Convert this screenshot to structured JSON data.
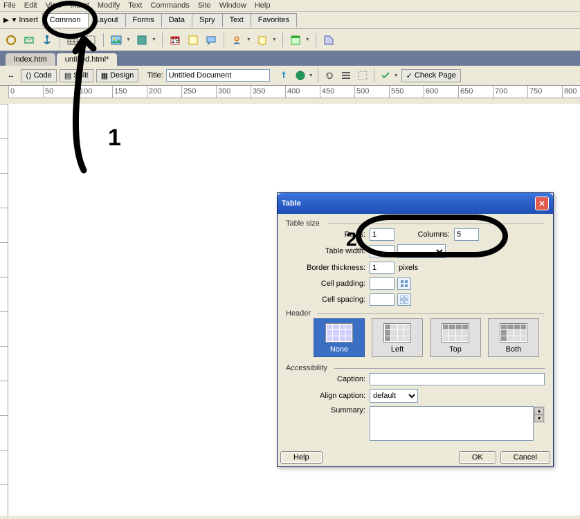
{
  "menu": [
    "File",
    "Edit",
    "View",
    "Insert",
    "Modify",
    "Text",
    "Commands",
    "Site",
    "Window",
    "Help"
  ],
  "insert": {
    "label": "Insert",
    "tabs": [
      "Common",
      "Layout",
      "Forms",
      "Data",
      "Spry",
      "Text",
      "Favorites"
    ],
    "active": 0
  },
  "doc_tabs": [
    {
      "label": "index.htm",
      "active": false
    },
    {
      "label": "untitled.html*",
      "active": true
    }
  ],
  "doc_toolbar": {
    "code": "Code",
    "split": "Split",
    "design": "Design",
    "title_label": "Title:",
    "title_value": "Untitled Document",
    "check_page": "Check Page"
  },
  "annotations": {
    "n1": "1",
    "n2": "2"
  },
  "dialog": {
    "title": "Table",
    "table_size": "Table size",
    "rows_label": "Rows:",
    "rows_value": "1",
    "cols_label": "Columns:",
    "cols_value": "5",
    "width_label": "Table width:",
    "width_value": "",
    "width_unit": "",
    "border_label": "Border thickness:",
    "border_value": "1",
    "border_unit": "pixels",
    "padding_label": "Cell padding:",
    "padding_value": "",
    "spacing_label": "Cell spacing:",
    "spacing_value": "",
    "header": "Header",
    "header_opts": [
      "None",
      "Left",
      "Top",
      "Both"
    ],
    "header_sel": 0,
    "access": "Accessibility",
    "caption_label": "Caption:",
    "caption_value": "",
    "align_label": "Align caption:",
    "align_value": "default",
    "summary_label": "Summary:",
    "summary_value": "",
    "help": "Help",
    "ok": "OK",
    "cancel": "Cancel"
  }
}
